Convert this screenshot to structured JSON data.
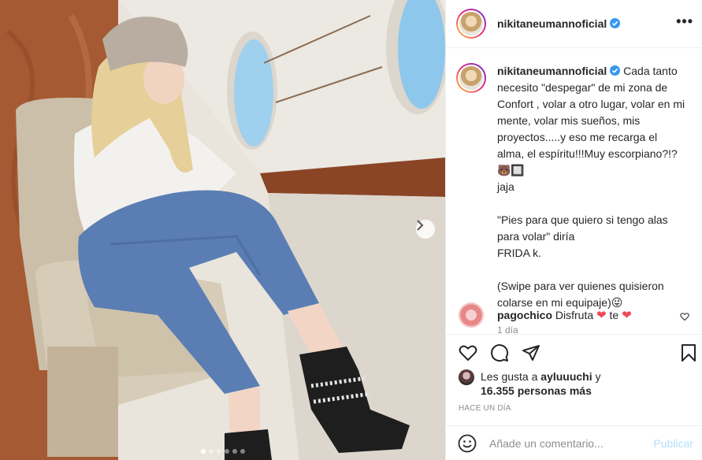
{
  "post": {
    "username": "nikitaneumannoficial",
    "verified": true,
    "more_label": "•••",
    "caption": {
      "username": "nikitaneumannoficial",
      "text": "Cada tanto necesito \"despegar\" de mi zona de Confort , volar a otro lugar, volar en mi mente, volar mis sueños, mis proyectos.....y eso me recarga el alma, el espíritu!!!Muy escorpiano?!? 🐻🔲\njaja\n\n\"Pies para que quiero si tengo alas para volar\" diría\nFRIDA k.\n\n(Swipe para ver quienes quisieron colarse en mi equipaje)😜",
      "time": "1 día"
    },
    "comments": [
      {
        "username": "pagochico",
        "text_before": "Disfruta",
        "text_middle": "te",
        "hearts": "❤"
      }
    ],
    "likes": {
      "prefix": "Les gusta a",
      "first_user": "ayluuuchi",
      "connector": "y",
      "count": "16.355 personas más"
    },
    "date": "HACE UN DÍA",
    "add_comment": {
      "placeholder": "Añade un comentario...",
      "publish_label": "Publicar"
    },
    "carousel": {
      "total": 6,
      "active": 0
    }
  },
  "colors": {
    "verified_blue": "#3897f0",
    "like_red": "#ed4956",
    "publish_disabled": "#b2dffc",
    "muted": "#8e8e8e"
  },
  "icons": {
    "like": "heart-icon",
    "comment": "comment-bubble-icon",
    "share": "paper-plane-icon",
    "save": "bookmark-icon",
    "emoji": "smiley-icon",
    "next": "chevron-right-icon",
    "more": "more-dots-icon"
  }
}
